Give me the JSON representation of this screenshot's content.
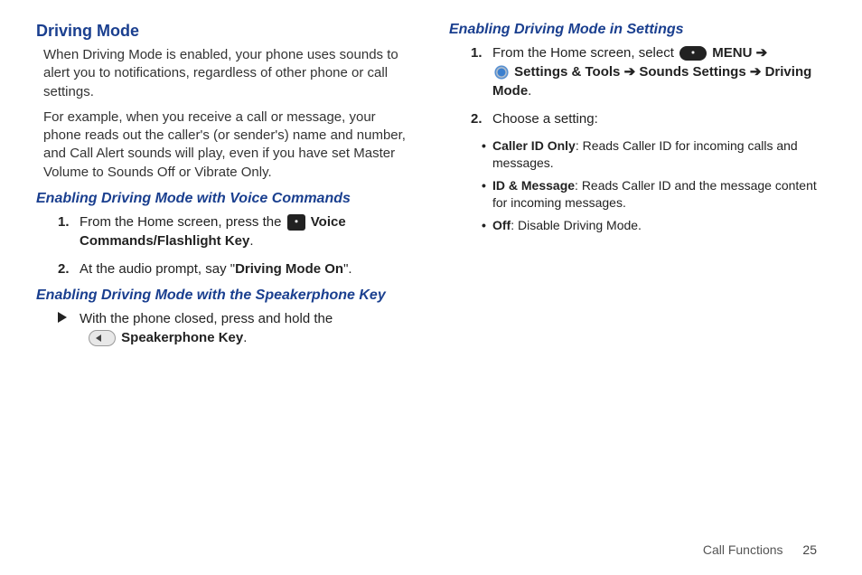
{
  "left": {
    "heading": "Driving Mode",
    "para1": "When Driving Mode is enabled, your phone uses sounds to alert you to notifications, regardless of other phone or call settings.",
    "para2": "For example, when you receive a call or message, your phone reads out the caller's (or sender's) name and number, and Call Alert sounds will play, even if you have set Master Volume to Sounds Off or Vibrate Only.",
    "sub1": "Enabling Driving Mode with Voice Commands",
    "step1_pre": "From the Home screen, press the ",
    "step1_bold": "Voice Commands/Flashlight Key",
    "step1_post": ".",
    "step2_pre": "At the audio prompt, say \"",
    "step2_bold": "Driving Mode On",
    "step2_post": "\".",
    "sub2": "Enabling Driving Mode with the Speakerphone Key",
    "arrow_pre": "With the phone closed, press and hold the ",
    "arrow_bold": "Speakerphone Key",
    "arrow_post": "."
  },
  "right": {
    "sub1": "Enabling Driving Mode in Settings",
    "r1_pre": "From the Home screen, select ",
    "r1_menu": "MENU",
    "arrow": " ➔ ",
    "r1_path1": "Settings & Tools",
    "r1_path2": "Sounds Settings",
    "r1_path3": "Driving Mode",
    "r1_end": ".",
    "r2": "Choose a setting:",
    "b1_label": "Caller ID Only",
    "b1_text": ": Reads Caller ID for incoming calls and messages.",
    "b2_label": "ID & Message",
    "b2_text": ": Reads Caller ID and the message content for incoming messages.",
    "b3_label": "Off",
    "b3_text": ": Disable Driving Mode."
  },
  "footer": {
    "section": "Call Functions",
    "page": "25"
  }
}
